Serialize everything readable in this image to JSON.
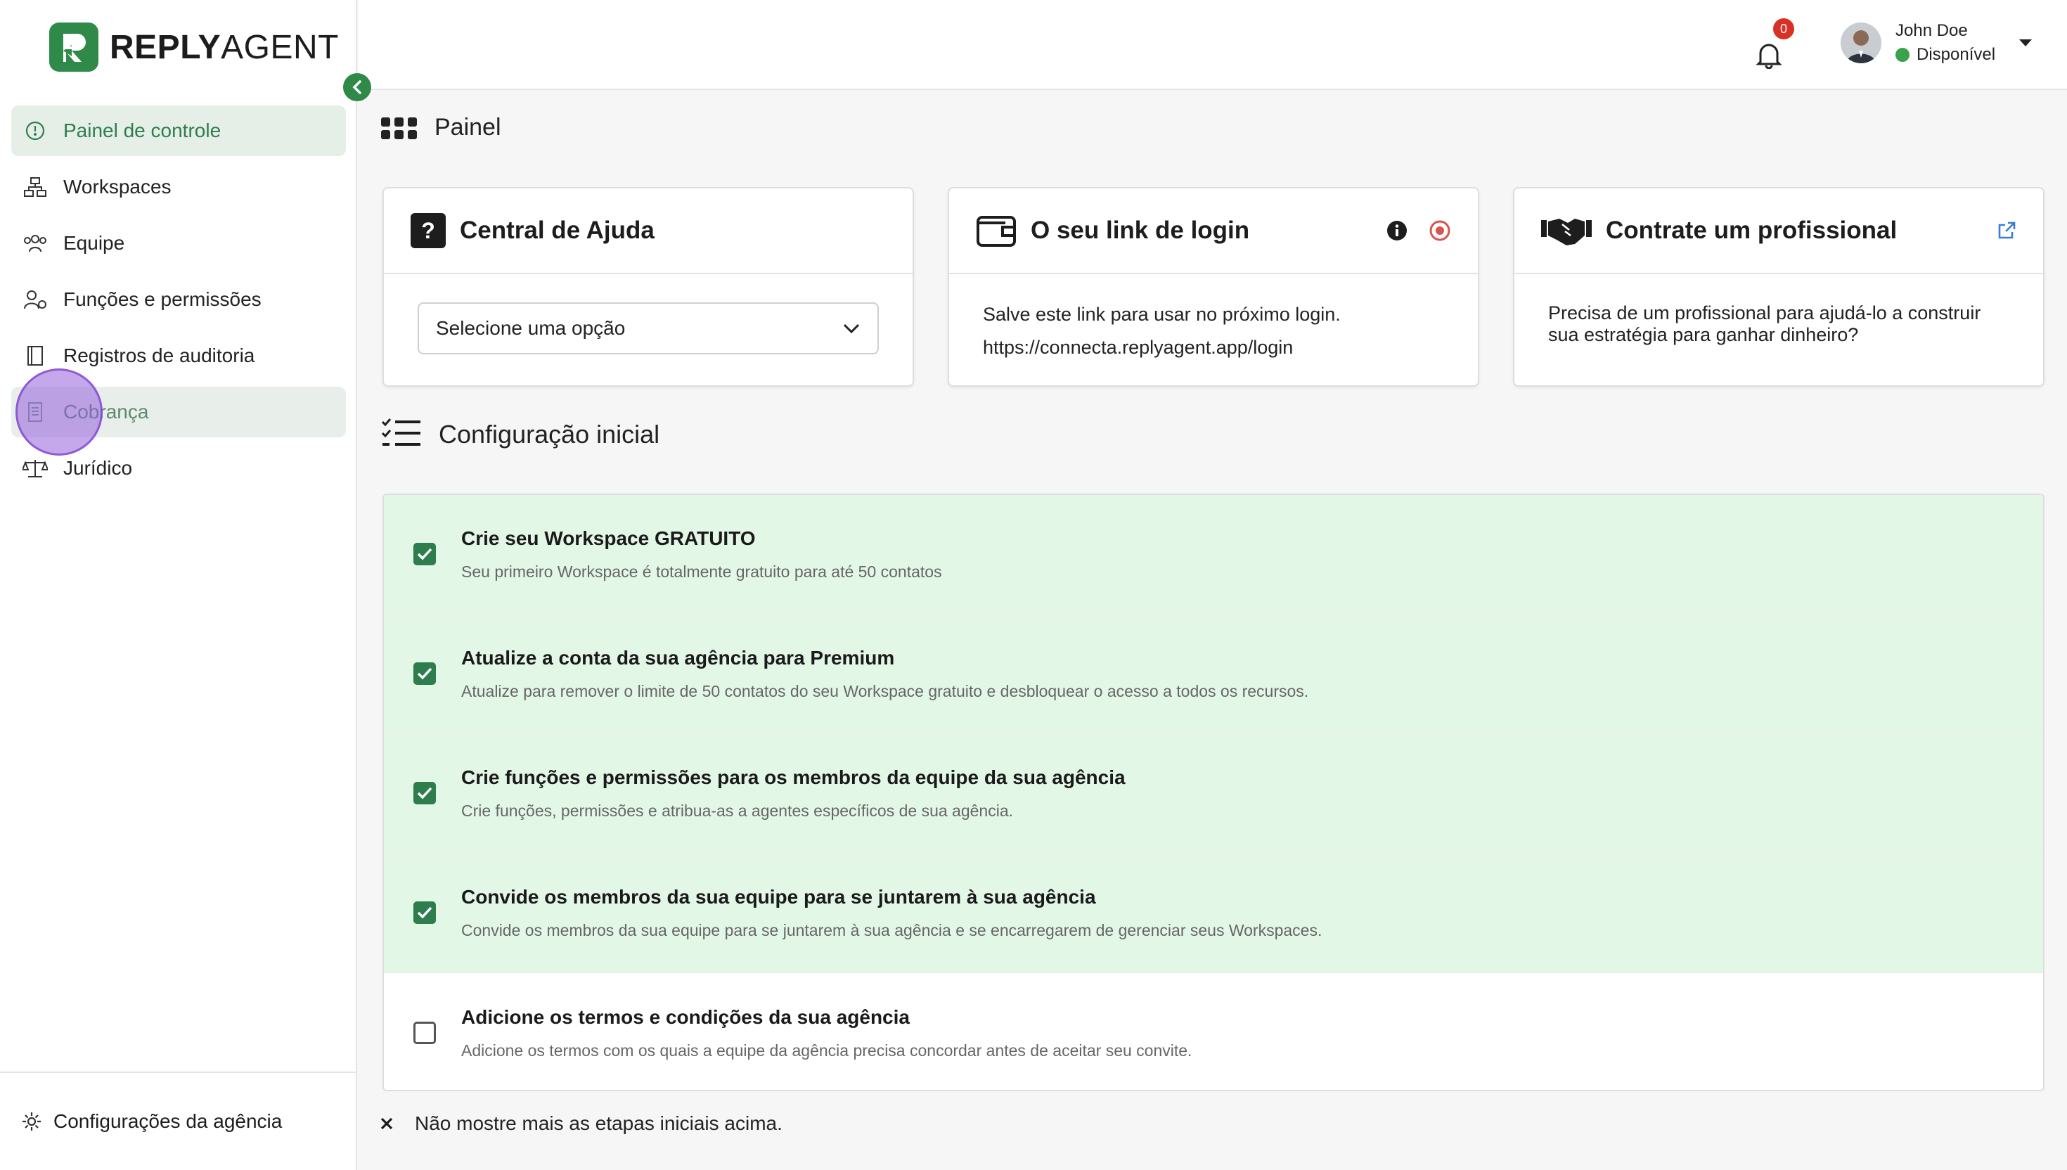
{
  "brand": {
    "name_bold": "REPLY",
    "name_light": "AGENT",
    "accent": "#2f8a4a"
  },
  "sidebar": {
    "items": [
      {
        "label": "Painel de controle",
        "icon": "dashboard-icon",
        "state": "active"
      },
      {
        "label": "Workspaces",
        "icon": "workspaces-icon"
      },
      {
        "label": "Equipe",
        "icon": "team-icon"
      },
      {
        "label": "Funções e permissões",
        "icon": "roles-icon"
      },
      {
        "label": "Registros de auditoria",
        "icon": "audit-log-icon"
      },
      {
        "label": "Cobrança",
        "icon": "billing-icon",
        "state": "hover"
      },
      {
        "label": "Jurídico",
        "icon": "legal-scale-icon"
      }
    ],
    "footer_label": "Configurações da agência"
  },
  "topbar": {
    "notification_count": "0",
    "user_name": "John Doe",
    "user_status": "Disponível",
    "status_color": "#3aa14c"
  },
  "page": {
    "title": "Painel"
  },
  "cards": {
    "help": {
      "title": "Central de Ajuda",
      "select_value": "Selecione uma opção"
    },
    "login": {
      "title": "O seu link de login",
      "text": "Salve este link para usar no próximo login.",
      "link": "https://connecta.replyagent.app/login"
    },
    "pro": {
      "title": "Contrate um profissional",
      "text": "Precisa de um profissional para ajudá-lo a construir sua estratégia para ganhar dinheiro?"
    }
  },
  "setup": {
    "title": "Configuração inicial",
    "steps": [
      {
        "title": "Crie seu Workspace GRATUITO",
        "desc": "Seu primeiro Workspace é totalmente gratuito para até 50 contatos",
        "done": true
      },
      {
        "title": "Atualize a conta da sua agência para Premium",
        "desc": "Atualize para remover o limite de 50 contatos do seu Workspace gratuito e desbloquear o acesso a todos os recursos.",
        "done": true
      },
      {
        "title": "Crie funções e permissões para os membros da equipe da sua agência",
        "desc": "Crie funções, permissões e atribua-as a agentes específicos de sua agência.",
        "done": true
      },
      {
        "title": "Convide os membros da sua equipe para se juntarem à sua agência",
        "desc": "Convide os membros da sua equipe para se juntarem à sua agência e se encarregarem de gerenciar seus Workspaces.",
        "done": true
      },
      {
        "title": "Adicione os termos e condições da sua agência",
        "desc": "Adicione os termos com os quais a equipe da agência precisa concordar antes de aceitar seu convite.",
        "done": false
      }
    ],
    "dismiss_label": "Não mostre mais as etapas iniciais acima."
  }
}
